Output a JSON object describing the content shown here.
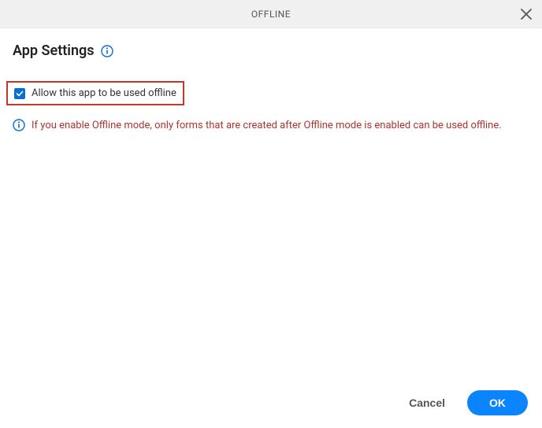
{
  "titlebar": {
    "title": "OFFLINE"
  },
  "section": {
    "heading": "App Settings"
  },
  "option": {
    "checked": true,
    "label": "Allow this app to be used offline"
  },
  "notice": {
    "text": "If you enable Offline mode, only forms that are created after Offline mode is enabled can be used offline."
  },
  "footer": {
    "cancel": "Cancel",
    "ok": "OK"
  },
  "colors": {
    "accent": "#0a84ff",
    "warning": "#b1332d",
    "highlight": "#c0392b"
  }
}
